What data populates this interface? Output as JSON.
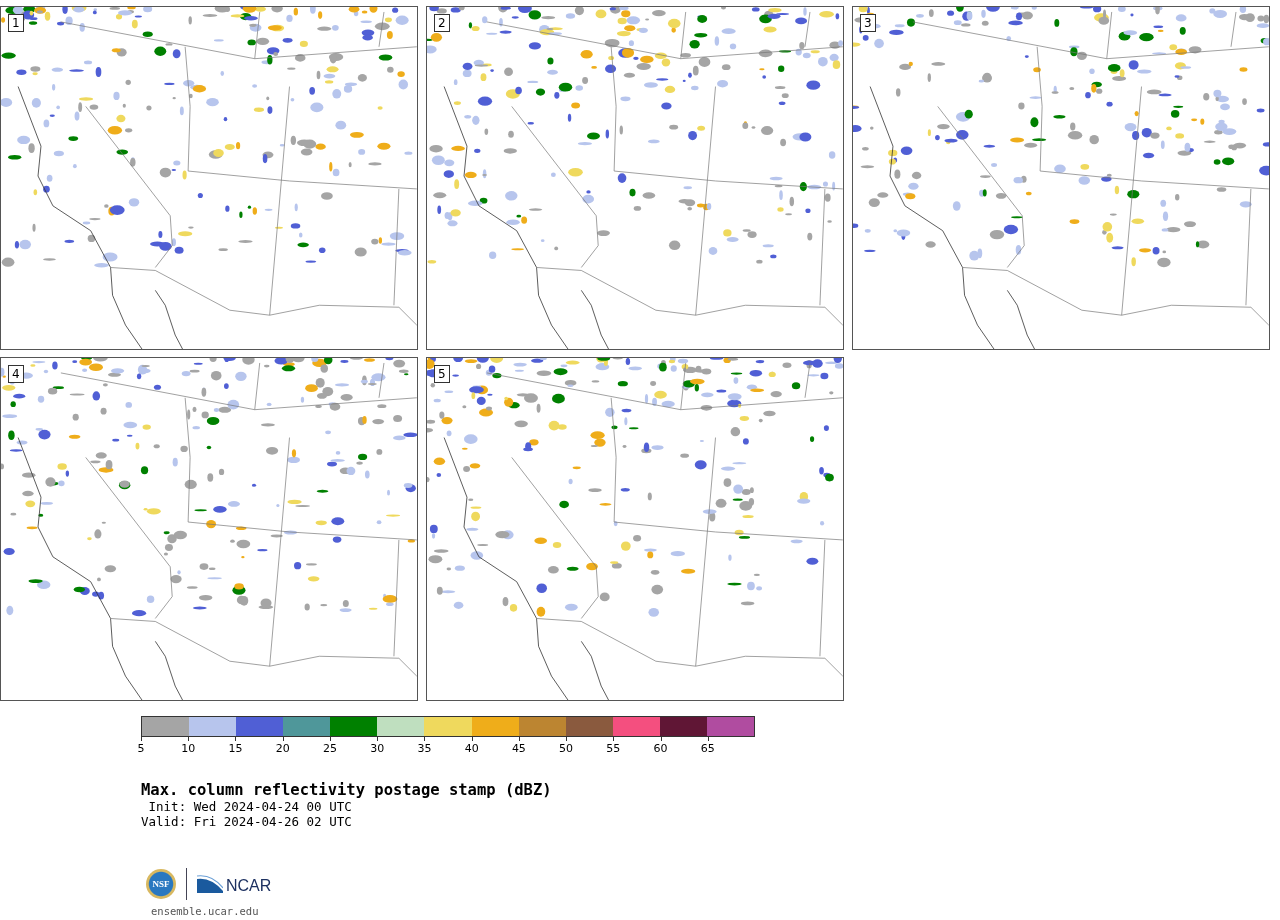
{
  "panels": [
    {
      "label": "1"
    },
    {
      "label": "2"
    },
    {
      "label": "3"
    },
    {
      "label": "4"
    },
    {
      "label": "5"
    }
  ],
  "colorbar": {
    "bins": [
      {
        "color": "#a5a5a5"
      },
      {
        "color": "#b7c5ed"
      },
      {
        "color": "#505fd5"
      },
      {
        "color": "#4f979a"
      },
      {
        "color": "#008000"
      },
      {
        "color": "#bfdfbf"
      },
      {
        "color": "#efd95d"
      },
      {
        "color": "#efad1a"
      },
      {
        "color": "#bc8531"
      },
      {
        "color": "#8a5a3e"
      },
      {
        "color": "#f44f7f"
      },
      {
        "color": "#601635"
      },
      {
        "color": "#b04ca0"
      }
    ],
    "ticks": [
      "5",
      "10",
      "15",
      "20",
      "25",
      "30",
      "35",
      "40",
      "45",
      "50",
      "55",
      "60",
      "65"
    ]
  },
  "title": "Max. column reflectivity postage stamp (dBZ)",
  "init": " Init: Wed 2024-04-24 00 UTC",
  "valid": "Valid: Fri 2024-04-26 02 UTC",
  "logo": {
    "nsf": "NSF",
    "ncar": "NCAR"
  },
  "footer": "ensemble.ucar.edu"
}
